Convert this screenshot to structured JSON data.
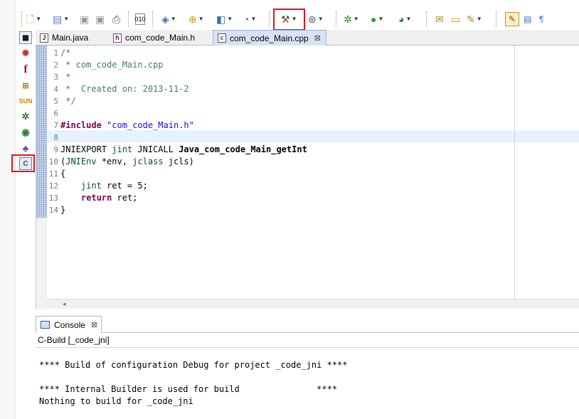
{
  "toolbar": {
    "icons": [
      "new-icon",
      "new-source-folder-icon",
      "save-icon",
      "save-all-icon",
      "print-icon",
      "binary-icon",
      "new-class-icon",
      "new-header-icon",
      "new-file-icon",
      "new-project-icon",
      "build-hammer-icon",
      "globe-icon",
      "debug-bug-icon",
      "run-icon",
      "external-tools-icon",
      "open-type-icon",
      "open-folder-icon",
      "pen-icon",
      "mark-occurrences-icon",
      "block-selection-icon",
      "show-whitespace-icon"
    ]
  },
  "left_strip": {
    "icons": [
      "perspective-icon",
      "debug-perspective-icon",
      "flash-icon",
      "java-ee-icon",
      "java-sun-icon",
      "debug-bug-icon",
      "globe-icon",
      "java-browsing-icon",
      "c-cpp-perspective-icon"
    ]
  },
  "editor": {
    "tabs": [
      {
        "label": "Main.java",
        "icon": "J"
      },
      {
        "label": "com_code_Main.h",
        "icon": "h"
      },
      {
        "label": "com_code_Main.cpp",
        "icon": "c",
        "active": true,
        "close": "⊠"
      }
    ],
    "line_numbers": [
      "1",
      "2",
      "3",
      "4",
      "5",
      "6",
      "7",
      "8",
      "9",
      "10",
      "11",
      "12",
      "13",
      "14"
    ],
    "code": {
      "l1": "/*",
      "l2": " * com_code_Main.cpp",
      "l3": " *",
      "l4": " *  Created on: 2013-11-2",
      "l5": " */",
      "l6": "",
      "l7_kw": "#include",
      "l7_str": "\"com_code_Main.h\"",
      "l8": "",
      "l9_a": "JNIEXPORT ",
      "l9_b": "jint",
      "l9_c": " JNICALL ",
      "l9_d": "Java_com_code_Main_getInt",
      "l10_a": "(",
      "l10_b": "JNIEnv",
      "l10_c": " *env, ",
      "l10_d": "jclass",
      "l10_e": " jcls)",
      "l11": "{",
      "l12_a": "    ",
      "l12_b": "jint",
      "l12_c": " ret = 5;",
      "l13_a": "    ",
      "l13_b": "return",
      "l13_c": " ret;",
      "l14": "}"
    },
    "scroll_arrow": "◂"
  },
  "console": {
    "tab_label": "Console",
    "tab_close": "⊠",
    "title": "C-Build [_code_jni]",
    "lines": [
      "",
      "**** Build of configuration Debug for project _code_jni ****",
      "",
      "**** Internal Builder is used for build               ****",
      "Nothing to build for _code_jni"
    ]
  }
}
